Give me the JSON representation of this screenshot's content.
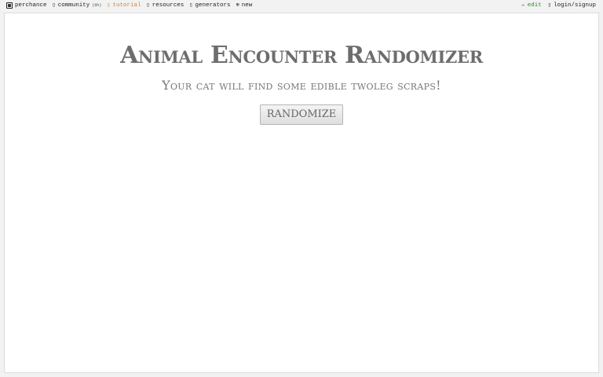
{
  "topbar": {
    "left": [
      {
        "icon": "dice-icon",
        "label": "perchance"
      },
      {
        "icon": "community-icon",
        "label": "community",
        "badge": "(6h)"
      },
      {
        "icon": "tutorial-icon",
        "label": "tutorial"
      },
      {
        "icon": "resources-icon",
        "label": "resources"
      },
      {
        "icon": "generators-icon",
        "label": "generators"
      },
      {
        "icon": "new-icon",
        "label": "new"
      }
    ],
    "right": [
      {
        "icon": "pencil-icon",
        "label": "edit"
      },
      {
        "icon": "user-icon",
        "label": "login/signup"
      }
    ]
  },
  "main": {
    "title": "Animal Encounter Randomizer",
    "output": "Your cat will find some edible twoleg scraps!",
    "randomize_label": "RANDOMIZE"
  },
  "colors": {
    "tutorial": "#d9822b",
    "edit": "#2e8b2e",
    "title": "#6d6d6d"
  }
}
